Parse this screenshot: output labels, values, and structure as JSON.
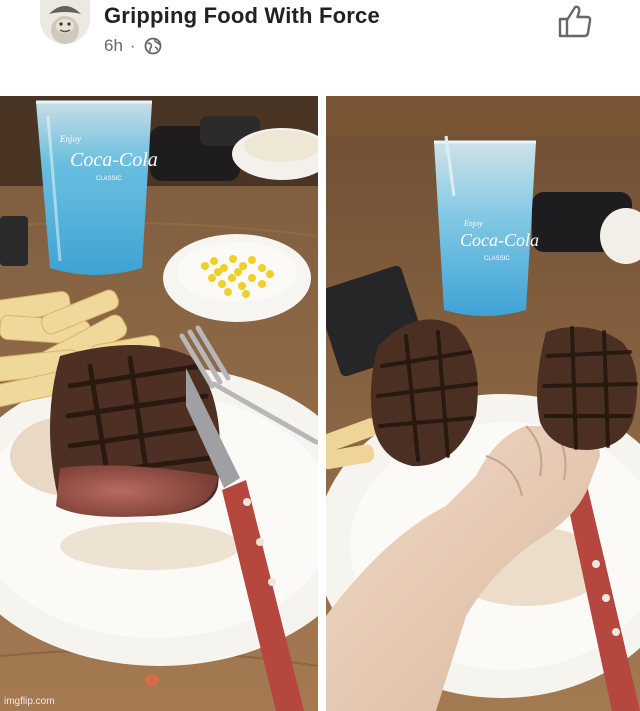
{
  "post": {
    "title": "Gripping Food With Force",
    "time": "6h",
    "separator": "·"
  },
  "photo_left": {
    "cup_brand": "Coca-Cola",
    "cup_enjoy": "Enjoy",
    "cup_classic": "CLASSIC"
  },
  "photo_right": {
    "cup_brand": "Coca-Cola",
    "cup_enjoy": "Enjoy",
    "cup_classic": "CLASSIC"
  },
  "watermark": "imgflip.com",
  "icons": {
    "like": "thumbs-up-icon",
    "audience": "globe-icon",
    "avatar": "profile-avatar"
  },
  "colors": {
    "title": "#222222",
    "meta": "#65676b",
    "drink": "#4fb6e6",
    "steak": "#5a3a28",
    "knife_handle": "#b5473e"
  }
}
